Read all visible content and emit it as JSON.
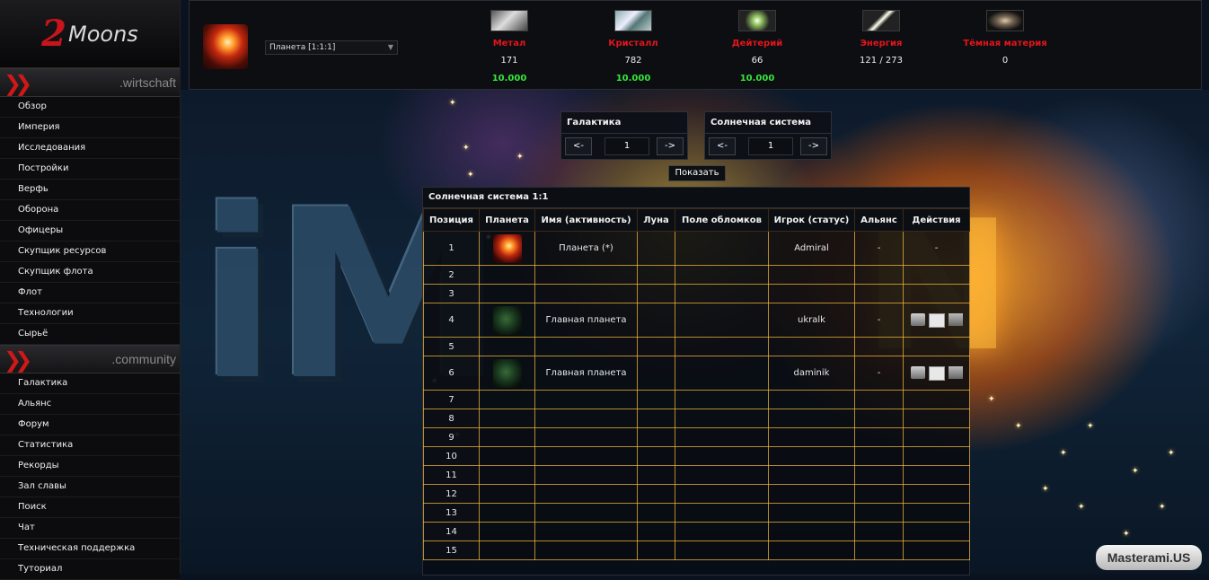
{
  "logo": {
    "number": "2",
    "name": "Moons"
  },
  "sidebar": {
    "sections": [
      {
        "title": ".wirtschaft",
        "items": [
          "Обзор",
          "Империя",
          "Исследования",
          "Постройки",
          "Верфь",
          "Оборона",
          "Офицеры",
          "Скупщик ресурсов",
          "Скупщик флота",
          "Флот",
          "Технологии",
          "Сырьё"
        ]
      },
      {
        "title": ".community",
        "items": [
          "Галактика",
          "Альянс",
          "Форум",
          "Статистика",
          "Рекорды",
          "Зал славы",
          "Поиск",
          "Чат",
          "Техническая поддержка",
          "Туториал"
        ]
      }
    ]
  },
  "planet_select": {
    "value": "Планета [1:1:1]"
  },
  "resources": [
    {
      "name": "Метал",
      "value": "171",
      "production": "10.000",
      "icon": "metal-icon"
    },
    {
      "name": "Кристалл",
      "value": "782",
      "production": "10.000",
      "icon": "crystal-icon"
    },
    {
      "name": "Дейтерий",
      "value": "66",
      "production": "10.000",
      "icon": "deuterium-icon"
    },
    {
      "name": "Энергия",
      "value": "121 / 273",
      "production": "",
      "icon": "energy-icon"
    },
    {
      "name": "Тёмная материя",
      "value": "0",
      "production": "",
      "icon": "dark-matter-icon"
    }
  ],
  "nav": {
    "galaxy": {
      "label": "Галактика",
      "value": "1",
      "prev": "<-",
      "next": "->"
    },
    "system": {
      "label": "Солнечная система",
      "value": "1",
      "prev": "<-",
      "next": "->"
    },
    "show_label": "Показать"
  },
  "galaxy_table": {
    "title": "Солнечная система 1:1",
    "headers": [
      "Позиция",
      "Планета",
      "Имя (активность)",
      "Луна",
      "Поле обломков",
      "Игрок (статус)",
      "Альянс",
      "Действия"
    ],
    "rows": [
      {
        "pos": "1",
        "planet": "red",
        "name": "Планета (*)",
        "player": "Admiral",
        "alliance": "-",
        "actions": "-"
      },
      {
        "pos": "2"
      },
      {
        "pos": "3"
      },
      {
        "pos": "4",
        "planet": "green",
        "name": "Главная планета",
        "player": "ukralk",
        "alliance": "-",
        "actions": "icons"
      },
      {
        "pos": "5"
      },
      {
        "pos": "6",
        "planet": "green",
        "name": "Главная планета",
        "player": "daminik",
        "alliance": "-",
        "actions": "icons"
      },
      {
        "pos": "7"
      },
      {
        "pos": "8"
      },
      {
        "pos": "9"
      },
      {
        "pos": "10"
      },
      {
        "pos": "11"
      },
      {
        "pos": "12"
      },
      {
        "pos": "13"
      },
      {
        "pos": "14"
      },
      {
        "pos": "15"
      }
    ]
  },
  "background": {
    "letters": "iM",
    "glow_letters": "N"
  },
  "watermark": "Masterami.US"
}
